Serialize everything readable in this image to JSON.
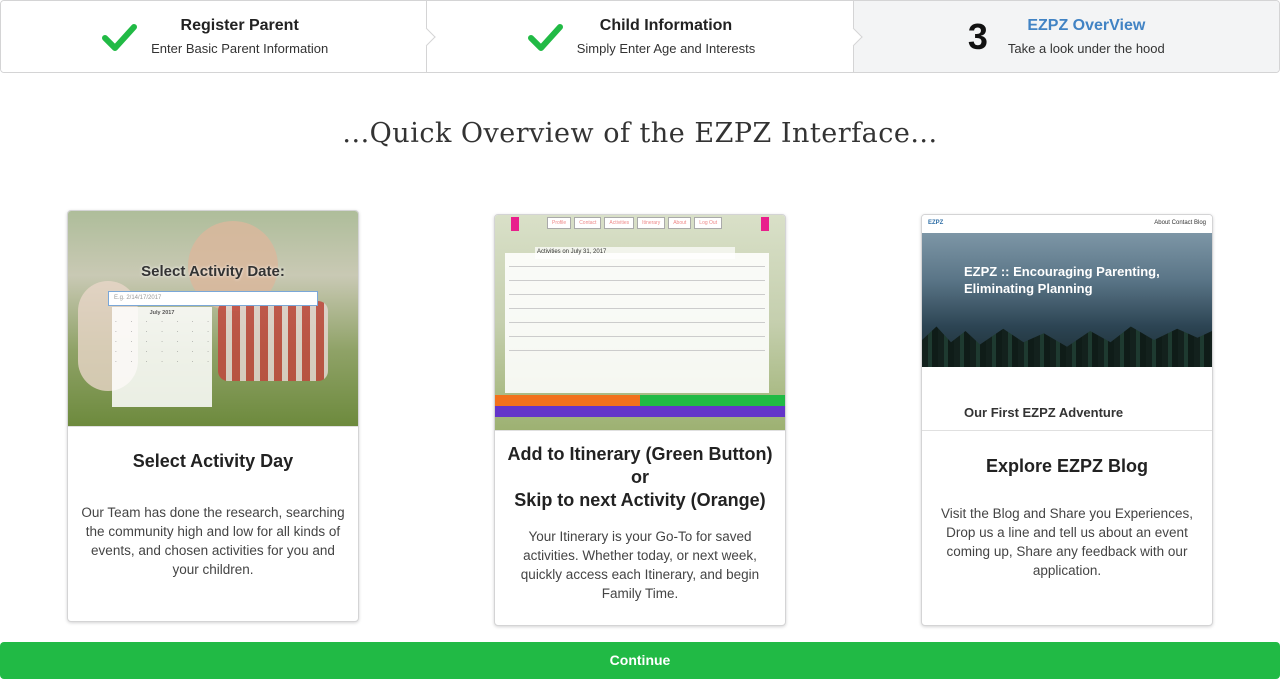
{
  "steps": [
    {
      "title": "Register Parent",
      "description": "Enter Basic Parent Information",
      "status": "completed"
    },
    {
      "title": "Child Information",
      "description": "Simply Enter Age and Interests",
      "status": "completed"
    },
    {
      "number": "3",
      "title": "EZPZ OverView",
      "description": "Take a look under the hood",
      "status": "active"
    }
  ],
  "heading": "...Quick Overview of the EZPZ Interface...",
  "cards": [
    {
      "title": "Select Activity Day",
      "description": "Our Team has done the research, searching the community high and low for all kinds of events, and chosen activities for you and your children.",
      "image": {
        "title": "Select Activity Date:",
        "input_placeholder": "E.g. 2/14/17/2017",
        "month": "July 2017"
      }
    },
    {
      "title_line1": "Add to Itinerary (Green Button)",
      "title_line2": "or",
      "title_line3": "Skip to next Activity (Orange)",
      "description": "Your Itinerary is your Go-To for saved activities. Whether today, or next week, quickly access each Itinerary, and begin Family Time.",
      "image": {
        "nav": [
          "Profile",
          "Contact",
          "Activities",
          "Itinerary",
          "About",
          "Log Out"
        ],
        "header": "Activities on July 31, 2017"
      }
    },
    {
      "title": "Explore EZPZ Blog",
      "description": "Visit the Blog and Share you Experiences, Drop us a line and tell us about an event coming up, Share any feedback with our application.",
      "image": {
        "brand": "EZPZ",
        "links": "About  Contact  Blog",
        "hero_title": "EZPZ :: Encouraging Parenting, Eliminating Planning",
        "post_title": "Our First EZPZ Adventure"
      }
    }
  ],
  "continue_label": "Continue",
  "colors": {
    "green": "#21ba45",
    "blue": "#4183c4",
    "orange": "#f2711c",
    "purple": "#6435c9"
  }
}
